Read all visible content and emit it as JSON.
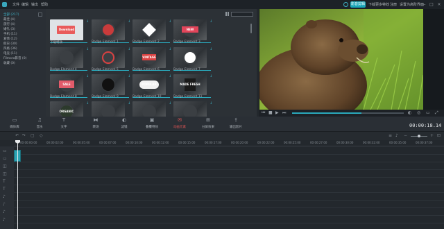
{
  "menu": [
    "文件",
    "编辑",
    "输出",
    "帮助"
  ],
  "top_right": {
    "active": "影音剪辑",
    "items": [
      "下载更多特效",
      "注册",
      "设置为高阶界面"
    ]
  },
  "sidebar": {
    "items": [
      {
        "label": "全部 (217)",
        "active": true
      },
      {
        "label": "最佳 (4)"
      },
      {
        "label": "旅行 (4)"
      },
      {
        "label": "婚礼 (3)"
      },
      {
        "label": "手机 (11)"
      },
      {
        "label": "爱情 (12)"
      },
      {
        "label": "假日 (30)"
      },
      {
        "label": "风格 (36)"
      },
      {
        "label": "电竞 (11)"
      },
      {
        "label": "Filmora影音 (0)"
      },
      {
        "label": "收藏 (0)"
      }
    ]
  },
  "library": {
    "items": [
      {
        "label": "下载特效",
        "thumb": "Download"
      },
      {
        "label": "Badge Element 1",
        "thumb": ""
      },
      {
        "label": "Badge Element 2",
        "thumb": ""
      },
      {
        "label": "Badge Element 3",
        "thumb": "NEW"
      },
      {
        "label": "Badge Element 4",
        "thumb": ""
      },
      {
        "label": "Badge Element 5",
        "thumb": ""
      },
      {
        "label": "Badge Element 6",
        "thumb": "VINTAGE"
      },
      {
        "label": "Badge Element 7",
        "thumb": ""
      },
      {
        "label": "Badge Element 8",
        "thumb": "SALE"
      },
      {
        "label": "Badge Element 9",
        "thumb": ""
      },
      {
        "label": "Badge Element 10",
        "thumb": "POPULAR"
      },
      {
        "label": "Badge Element 11",
        "thumb": "MADE FRESH"
      },
      {
        "label": "",
        "thumb": "ORGANIC"
      },
      {
        "label": "",
        "thumb": ""
      },
      {
        "label": "",
        "thumb": ""
      },
      {
        "label": "",
        "thumb": ""
      }
    ]
  },
  "toolbar": {
    "tools": [
      {
        "label": "媒体库",
        "icon": "folder-icon"
      },
      {
        "label": "音乐",
        "icon": "music-icon"
      },
      {
        "label": "文字",
        "icon": "text-icon"
      },
      {
        "label": "转场",
        "icon": "transition-icon"
      },
      {
        "label": "滤镜",
        "icon": "filter-icon"
      },
      {
        "label": "叠覆特效",
        "icon": "overlay-icon"
      },
      {
        "label": "动画元素",
        "icon": "element-icon",
        "active": true
      },
      {
        "label": "分屏效果",
        "icon": "split-screen-icon"
      },
      {
        "label": "输出影片",
        "icon": "export-icon"
      }
    ],
    "timecode": "00:00:18.14"
  },
  "ruler": {
    "ticks": [
      "00:00:00:00",
      "00:00:02:00",
      "00:00:05:00",
      "00:00:07:00",
      "00:00:10:00",
      "00:00:12:00",
      "00:00:15:00",
      "00:00:17:00",
      "00:00:20:00",
      "00:00:22:00",
      "00:00:25:00",
      "00:00:27:00",
      "00:00:30:00",
      "00:00:32:00",
      "00:00:35:00",
      "00:00:37:00"
    ]
  },
  "colors": {
    "accent": "#2aa9bc",
    "active_tool": "#e05555"
  }
}
